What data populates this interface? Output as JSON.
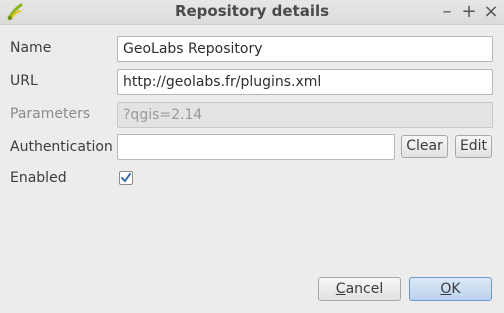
{
  "window": {
    "title": "Repository details",
    "controls": {
      "minimize": "–",
      "maximize": "+",
      "close": "×"
    }
  },
  "form": {
    "name": {
      "label": "Name",
      "value": "GeoLabs Repository"
    },
    "url": {
      "label": "URL",
      "value": "http://geolabs.fr/plugins.xml"
    },
    "parameters": {
      "label": "Parameters",
      "value": "?qgis=2.14"
    },
    "authentication": {
      "label": "Authentication",
      "value": "",
      "clear_label": "Clear",
      "edit_label": "Edit"
    },
    "enabled": {
      "label": "Enabled",
      "checked": true
    }
  },
  "buttons": {
    "cancel_label_first": "C",
    "cancel_label_rest": "ancel",
    "ok_label_first": "O",
    "ok_label_rest": "K"
  },
  "icons": {
    "app": "qgis-icon",
    "checkbox": "check-icon"
  },
  "colors": {
    "window_bg": "#edeceb",
    "default_button": "#bcd3ee",
    "check_mark": "#3d6fb0"
  }
}
